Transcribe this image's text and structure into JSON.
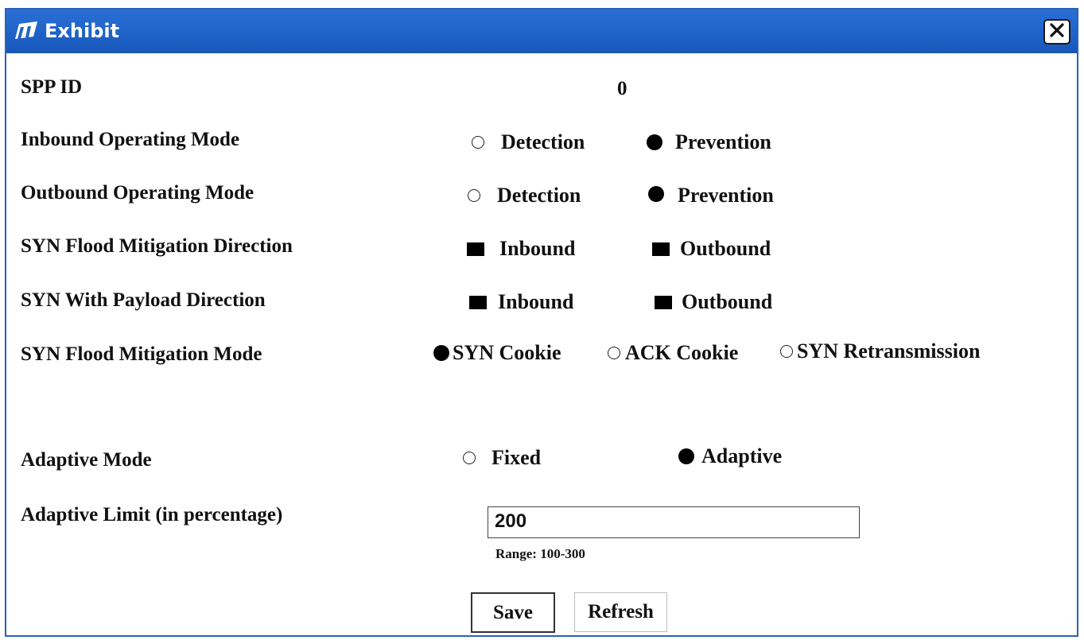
{
  "window": {
    "title": "Exhibit",
    "accent": "#1f63c8"
  },
  "fields": {
    "spp_id": {
      "label": "SPP ID",
      "value": "0"
    },
    "inbound_mode": {
      "label": "Inbound Operating Mode",
      "options": [
        "Detection",
        "Prevention"
      ],
      "selected": "Prevention"
    },
    "outbound_mode": {
      "label": "Outbound Operating Mode",
      "options": [
        "Detection",
        "Prevention"
      ],
      "selected": "Prevention"
    },
    "syn_flood_direction": {
      "label": "SYN Flood Mitigation Direction",
      "options": [
        "Inbound",
        "Outbound"
      ],
      "checked": [
        "Inbound",
        "Outbound"
      ]
    },
    "syn_payload_direction": {
      "label": "SYN With Payload Direction",
      "options": [
        "Inbound",
        "Outbound"
      ],
      "checked": [
        "Inbound",
        "Outbound"
      ]
    },
    "syn_flood_mode": {
      "label": "SYN Flood Mitigation  Mode",
      "options": [
        "SYN Cookie",
        "ACK Cookie",
        "SYN Retransmission"
      ],
      "selected": "SYN Cookie"
    },
    "adaptive_mode": {
      "label": "Adaptive Mode",
      "options": [
        "Fixed",
        "Adaptive"
      ],
      "selected": "Adaptive"
    },
    "adaptive_limit": {
      "label": "Adaptive Limit (in percentage)",
      "value": "200",
      "hint": "Range: 100-300"
    }
  },
  "buttons": {
    "save": "Save",
    "refresh": "Refresh"
  }
}
